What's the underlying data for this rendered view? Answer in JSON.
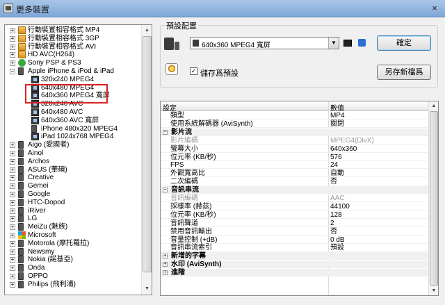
{
  "window": {
    "title": "更多裝置",
    "close_glyph": "×"
  },
  "tree": {
    "items": [
      {
        "label": "行動裝置相容格式 MP4",
        "level": 0,
        "expander": "+",
        "icon": "folder-icon"
      },
      {
        "label": "行動裝置相容格式 3GP",
        "level": 0,
        "expander": "+",
        "icon": "folder-icon"
      },
      {
        "label": "行動裝置相容格式 AVI",
        "level": 0,
        "expander": "+",
        "icon": "folder-icon"
      },
      {
        "label": "HD AVC(H264)",
        "level": 0,
        "expander": "+",
        "icon": "folder-icon"
      },
      {
        "label": "Sony PSP & PS3",
        "level": 0,
        "expander": "+",
        "icon": "psp-icon"
      },
      {
        "label": "Apple iPhone & iPod & iPad",
        "level": 0,
        "expander": "−",
        "icon": "apple-icon"
      },
      {
        "label": "320x240 MPEG4",
        "level": 1,
        "expander": "",
        "icon": "film-icon"
      },
      {
        "label": "640x480 MPEG4",
        "level": 1,
        "expander": "",
        "icon": "film-icon"
      },
      {
        "label": "640x360 MPEG4 寬屏",
        "level": 1,
        "expander": "",
        "icon": "film-icon"
      },
      {
        "label": "320x240 AVC",
        "level": 1,
        "expander": "",
        "icon": "film-icon"
      },
      {
        "label": "640x480 AVC",
        "level": 1,
        "expander": "",
        "icon": "film-icon"
      },
      {
        "label": "640x360 AVC 寬屏",
        "level": 1,
        "expander": "",
        "icon": "film-icon"
      },
      {
        "label": "iPhone 480x320 MPEG4",
        "level": 1,
        "expander": "",
        "icon": "phone-icon"
      },
      {
        "label": "iPad 1024x768 MPEG4",
        "level": 1,
        "expander": "",
        "icon": "tablet-icon"
      },
      {
        "label": "Aigo (愛國者)",
        "level": 0,
        "expander": "+",
        "icon": "device-icon"
      },
      {
        "label": "Ainol",
        "level": 0,
        "expander": "+",
        "icon": "device-icon"
      },
      {
        "label": "Archos",
        "level": 0,
        "expander": "+",
        "icon": "device-icon"
      },
      {
        "label": "ASUS (華碩)",
        "level": 0,
        "expander": "+",
        "icon": "device-icon"
      },
      {
        "label": "Creative",
        "level": 0,
        "expander": "+",
        "icon": "device-icon"
      },
      {
        "label": "Gemei",
        "level": 0,
        "expander": "+",
        "icon": "device-icon"
      },
      {
        "label": "Google",
        "level": 0,
        "expander": "+",
        "icon": "device-icon"
      },
      {
        "label": "HTC-Dopod",
        "level": 0,
        "expander": "+",
        "icon": "device-icon"
      },
      {
        "label": "iRiver",
        "level": 0,
        "expander": "+",
        "icon": "device-icon"
      },
      {
        "label": "LG",
        "level": 0,
        "expander": "+",
        "icon": "device-icon"
      },
      {
        "label": "MeiZu (魅族)",
        "level": 0,
        "expander": "+",
        "icon": "device-icon"
      },
      {
        "label": "Microsoft",
        "level": 0,
        "expander": "+",
        "icon": "microsoft-icon"
      },
      {
        "label": "Motorola (摩托羅拉)",
        "level": 0,
        "expander": "+",
        "icon": "device-icon"
      },
      {
        "label": "Newsmy",
        "level": 0,
        "expander": "+",
        "icon": "device-icon"
      },
      {
        "label": "Nokia (諾基亞)",
        "level": 0,
        "expander": "+",
        "icon": "device-icon"
      },
      {
        "label": "Onda",
        "level": 0,
        "expander": "+",
        "icon": "device-icon"
      },
      {
        "label": "OPPO",
        "level": 0,
        "expander": "+",
        "icon": "device-icon"
      },
      {
        "label": "Philips (飛利浦)",
        "level": 0,
        "expander": "+",
        "icon": "device-icon"
      }
    ],
    "highlighted": [
      "640x480 MPEG4",
      "640x360 MPEG4 寬屏"
    ],
    "highlight_color": "#d92121",
    "scroll_up_glyph": "▲",
    "scroll_down_glyph": "▼"
  },
  "preset": {
    "legend": "預設配置",
    "selected": "640x360 MPEG4 寬屏",
    "dropdown_arrow": "▼",
    "ok_label": "確定",
    "save_as_label": "另存新檔爲",
    "save_preset_label": "儲存爲預設",
    "save_preset_checked": "✓"
  },
  "properties": {
    "col_setting": "設定",
    "col_value": "數值",
    "rows": [
      {
        "type": "row",
        "key": "類型",
        "value": "MP4"
      },
      {
        "type": "row",
        "key": "使用系統解碼器 (AviSynth)",
        "value": "關閉"
      },
      {
        "type": "cat",
        "key": "影片流",
        "expander": "⊟"
      },
      {
        "type": "row",
        "key": "影片編碼",
        "value": "MPEG4(DivX)",
        "disabled": true
      },
      {
        "type": "row",
        "key": "螢幕大小",
        "value": "640x360"
      },
      {
        "type": "row",
        "key": "位元率 (KB/秒)",
        "value": "576"
      },
      {
        "type": "row",
        "key": "FPS",
        "value": "24"
      },
      {
        "type": "row",
        "key": "外觀寬高比",
        "value": "自動"
      },
      {
        "type": "row",
        "key": "二次編碼",
        "value": "否"
      },
      {
        "type": "cat",
        "key": "音訊串流",
        "expander": "⊟"
      },
      {
        "type": "row",
        "key": "音訊編碼",
        "value": "AAC",
        "disabled": true
      },
      {
        "type": "row",
        "key": "採樣率 (赫茲)",
        "value": "44100"
      },
      {
        "type": "row",
        "key": "位元率 (KB/秒)",
        "value": "128"
      },
      {
        "type": "row",
        "key": "音訊聲道",
        "value": "2"
      },
      {
        "type": "row",
        "key": "禁用音訊輸出",
        "value": "否"
      },
      {
        "type": "row",
        "key": "音量控制 (+dB)",
        "value": "0 dB"
      },
      {
        "type": "row",
        "key": "音訊串流索引",
        "value": "預設"
      },
      {
        "type": "cat",
        "key": "新增的字幕",
        "expander": "⊞"
      },
      {
        "type": "cat",
        "key": "水印 (AviSynth)",
        "expander": "⊞"
      },
      {
        "type": "cat",
        "key": "進階",
        "expander": "⊞"
      }
    ],
    "scroll_up_glyph": "▲",
    "scroll_down_glyph": "▼"
  }
}
